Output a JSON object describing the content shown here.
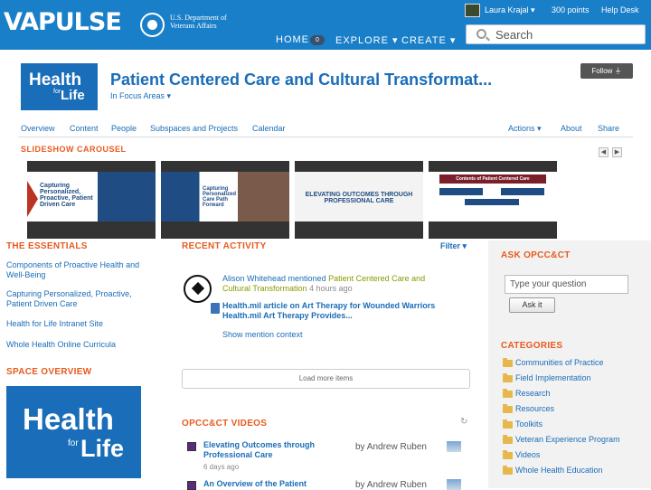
{
  "header": {
    "logo": "VAPULSE",
    "org_name": "U.S. Department of Veterans Affairs",
    "user": "Laura Krajal",
    "points": "300 points",
    "help": "Help Desk",
    "nav": [
      "HOME",
      "EXPLORE",
      "CREATE"
    ],
    "nav_badge": "0",
    "search_placeholder": "Search"
  },
  "space": {
    "logo_big": "Health",
    "logo_small": "for",
    "logo_life": "Life",
    "title": "Patient Centered Care and Cultural Transformat...",
    "subtitle": "In Focus Areas",
    "follow_label": "Follow",
    "tabs": [
      "Overview",
      "Content",
      "People",
      "Subspaces and Projects",
      "Calendar"
    ],
    "right_tabs": [
      "Actions",
      "About",
      "Share"
    ]
  },
  "carousel": {
    "title": "SLIDESHOW CAROUSEL",
    "prev": "◀",
    "next": "▶",
    "slides": [
      {
        "caption": "Capturing Personalized, Proactive, Patient Driven Care"
      },
      {
        "caption": "Capturing Personalized Care Path Forward"
      },
      {
        "caption": "ELEVATING OUTCOMES THROUGH PROFESSIONAL CARE"
      },
      {
        "caption": "Contents of Patient Centered Care"
      }
    ]
  },
  "essentials": {
    "title": "THE ESSENTIALS",
    "links": [
      "Components of Proactive Health and Well-Being",
      "Capturing Personalized, Proactive, Patient Driven Care",
      "Health for Life Intranet Site",
      "Whole Health Online Curricula"
    ]
  },
  "overview": {
    "title": "SPACE OVERVIEW",
    "logo_big": "Health",
    "logo_small": "for",
    "logo_life": "Life"
  },
  "activity": {
    "title": "RECENT ACTIVITY",
    "filter": "Filter",
    "actor": "Alison Whitehead mentioned",
    "space": "Patient Centered Care and Cultural Transformation",
    "time": "4 hours ago",
    "link_text": "Health.mil article on Art Therapy for Wounded Warriors Health.mil     Art Therapy Provides...",
    "mention_context": "Show mention context",
    "load_more": "Load more items"
  },
  "videos": {
    "title": "OPCC&CT VIDEOS",
    "items": [
      {
        "title": "Elevating Outcomes through Professional Care",
        "author": "by Andrew Ruben",
        "age": "6 days ago"
      },
      {
        "title": "An Overview of the Patient",
        "author": "by Andrew Ruben",
        "age": ""
      }
    ]
  },
  "ask": {
    "title": "ASK OPCC&CT",
    "placeholder": "Type your question",
    "button": "Ask it"
  },
  "categories": {
    "title": "CATEGORIES",
    "items": [
      "Communities of Practice",
      "Field Implementation",
      "Research",
      "Resources",
      "Toolkits",
      "Veteran Experience Program",
      "Videos",
      "Whole Health Education"
    ]
  },
  "colors": {
    "brand_blue": "#1a7fc9",
    "link_blue": "#1a6db8",
    "section_orange": "#e85a1e",
    "highlight_green": "#8a9a00"
  }
}
